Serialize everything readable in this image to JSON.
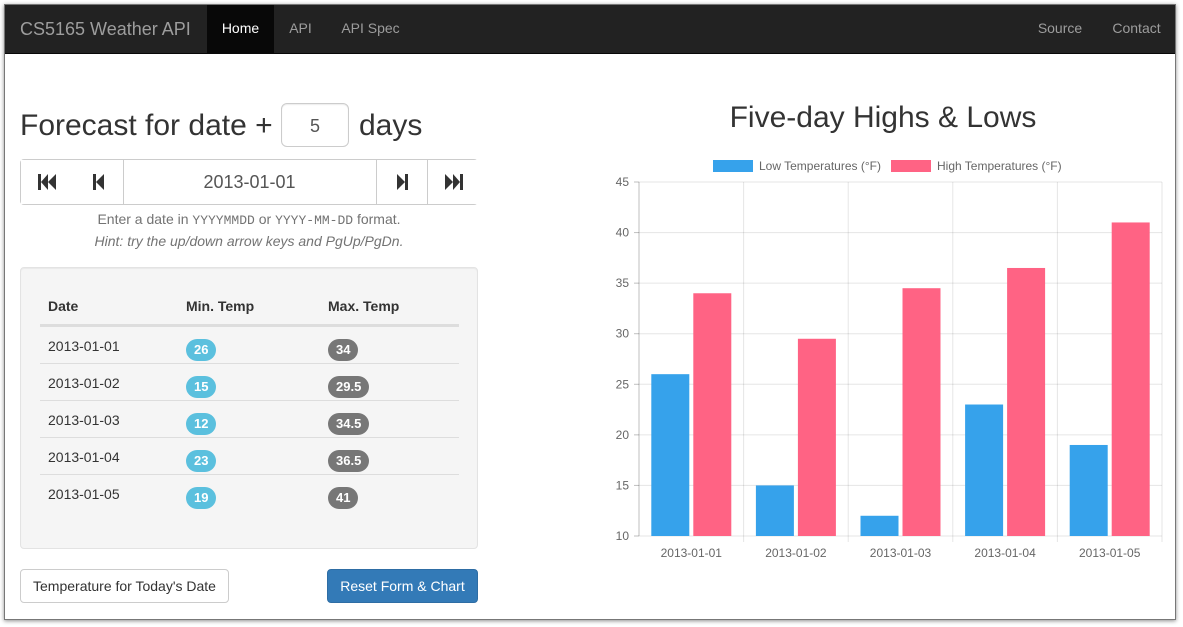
{
  "navbar": {
    "brand": "CS5165 Weather API",
    "items": [
      {
        "label": "Home",
        "active": true
      },
      {
        "label": "API",
        "active": false
      },
      {
        "label": "API Spec",
        "active": false
      }
    ],
    "right_items": [
      {
        "label": "Source"
      },
      {
        "label": "Contact"
      }
    ]
  },
  "forecast": {
    "heading_prefix": "Forecast for date +",
    "days_value": "5",
    "heading_suffix": "days",
    "date_value": "2013-01-01",
    "help_text_1": "Enter a date in",
    "help_code_1": "YYYYMMDD",
    "help_or": "or",
    "help_code_2": "YYYY-MM-DD",
    "help_format": "format.",
    "hint": "Hint: try the up/down arrow keys and PgUp/PgDn."
  },
  "icons": {
    "first": "skip-to-start-icon",
    "prev": "step-backward-icon",
    "next": "step-forward-icon",
    "last": "skip-to-end-icon"
  },
  "table": {
    "headers": [
      "Date",
      "Min. Temp",
      "Max. Temp"
    ],
    "rows": [
      {
        "date": "2013-01-01",
        "min": "26",
        "max": "34"
      },
      {
        "date": "2013-01-02",
        "min": "15",
        "max": "29.5"
      },
      {
        "date": "2013-01-03",
        "min": "12",
        "max": "34.5"
      },
      {
        "date": "2013-01-04",
        "min": "23",
        "max": "36.5"
      },
      {
        "date": "2013-01-05",
        "min": "19",
        "max": "41"
      }
    ]
  },
  "buttons": {
    "today": "Temperature for Today's Date",
    "reset": "Reset Form & Chart"
  },
  "colors": {
    "min_badge": "#5bc0de",
    "max_badge": "#777777",
    "primary": "#337ab7",
    "low_series": "#36a2eb",
    "high_series": "#ff6384"
  },
  "chart_data": {
    "type": "bar",
    "title": "Five-day Highs & Lows",
    "categories": [
      "2013-01-01",
      "2013-01-02",
      "2013-01-03",
      "2013-01-04",
      "2013-01-05"
    ],
    "series": [
      {
        "name": "Low Temperatures (°F)",
        "values": [
          26,
          15,
          12,
          23,
          19
        ],
        "color": "#36a2eb"
      },
      {
        "name": "High Temperatures (°F)",
        "values": [
          34,
          29.5,
          34.5,
          36.5,
          41
        ],
        "color": "#ff6384"
      }
    ],
    "ylim": [
      10,
      45
    ],
    "yticks": [
      "10",
      "15",
      "20",
      "25",
      "30",
      "35",
      "40",
      "45"
    ],
    "grid": true,
    "legend": "top"
  }
}
